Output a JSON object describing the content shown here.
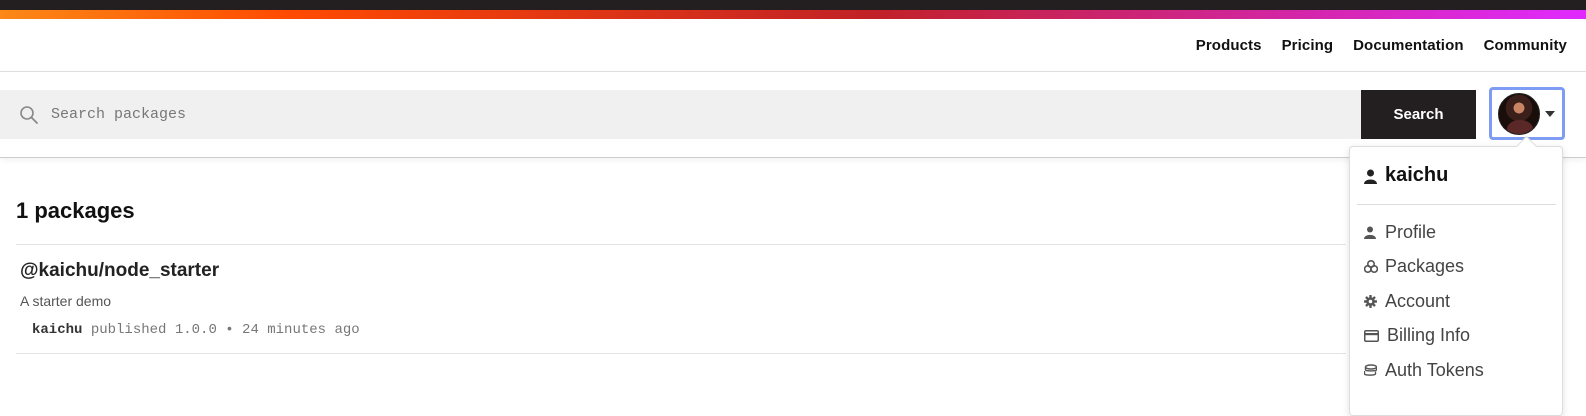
{
  "topnav": {
    "links": [
      "Products",
      "Pricing",
      "Documentation",
      "Community"
    ]
  },
  "search": {
    "placeholder": "Search packages",
    "value": "",
    "button_label": "Search"
  },
  "results": {
    "count_label": "1 packages",
    "packages": [
      {
        "name": "@kaichu/node_starter",
        "description": "A starter demo",
        "author": "kaichu",
        "published_text": "published 1.0.0 • 24 minutes ago"
      }
    ]
  },
  "user_menu": {
    "username": "kaichu",
    "items": [
      {
        "label": "Profile",
        "icon": "person-icon"
      },
      {
        "label": "Packages",
        "icon": "packages-icon"
      },
      {
        "label": "Account",
        "icon": "gear-icon"
      },
      {
        "label": "Billing Info",
        "icon": "credit-card-icon"
      },
      {
        "label": "Auth Tokens",
        "icon": "tokens-icon"
      }
    ]
  },
  "colors": {
    "dark": "#231f20",
    "accent_gradient": [
      "#fb8817",
      "#ff4b01",
      "#c12127",
      "#e02aff"
    ],
    "focus_ring": "#7f9cf5"
  }
}
